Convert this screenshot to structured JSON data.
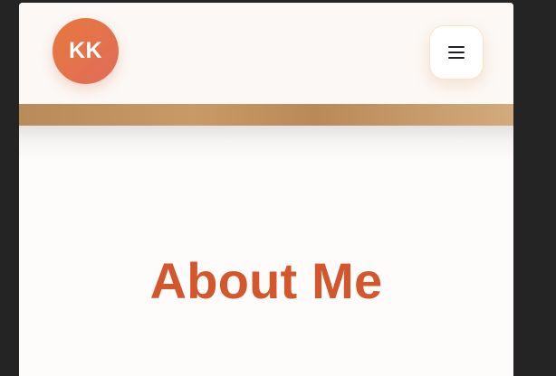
{
  "header": {
    "avatar_initials": "KK",
    "menu_icon": "hamburger-menu-icon"
  },
  "hero": {
    "title": "About Me"
  },
  "colors": {
    "avatar_start": "#e7793d",
    "avatar_end": "#e06c5a",
    "title": "#d4562d",
    "gold_band": "#c49863",
    "page_background": "#242424"
  }
}
